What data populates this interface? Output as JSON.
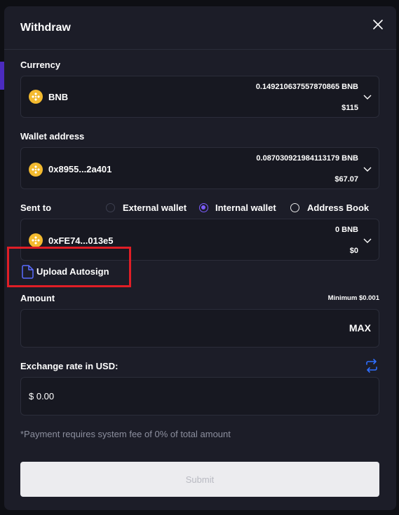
{
  "dialog": {
    "title": "Withdraw"
  },
  "currency": {
    "label": "Currency",
    "name": "BNB",
    "balance": "0.149210637557870865 BNB",
    "usd": "$115"
  },
  "wallet": {
    "label": "Wallet address",
    "address": "0x8955...2a401",
    "balance": "0.087030921984113179 BNB",
    "usd": "$67.07"
  },
  "sent_to": {
    "label": "Sent to",
    "options": [
      "External wallet",
      "Internal wallet",
      "Address Book"
    ],
    "selected": "Internal wallet",
    "address": "0xFE74...013e5",
    "balance": "0 BNB",
    "usd": "$0"
  },
  "upload": {
    "label": "Upload Autosign"
  },
  "amount": {
    "label": "Amount",
    "minimum": "Minimum $0.001",
    "max_label": "MAX"
  },
  "exchange": {
    "label": "Exchange rate in USD:",
    "value": "$ 0.00"
  },
  "fee_note": "*Payment requires system fee of 0% of total amount",
  "submit_label": "Submit",
  "colors": {
    "accent": "#7c5cff",
    "coin": "#f3ba2f",
    "highlight": "#e01e26"
  }
}
